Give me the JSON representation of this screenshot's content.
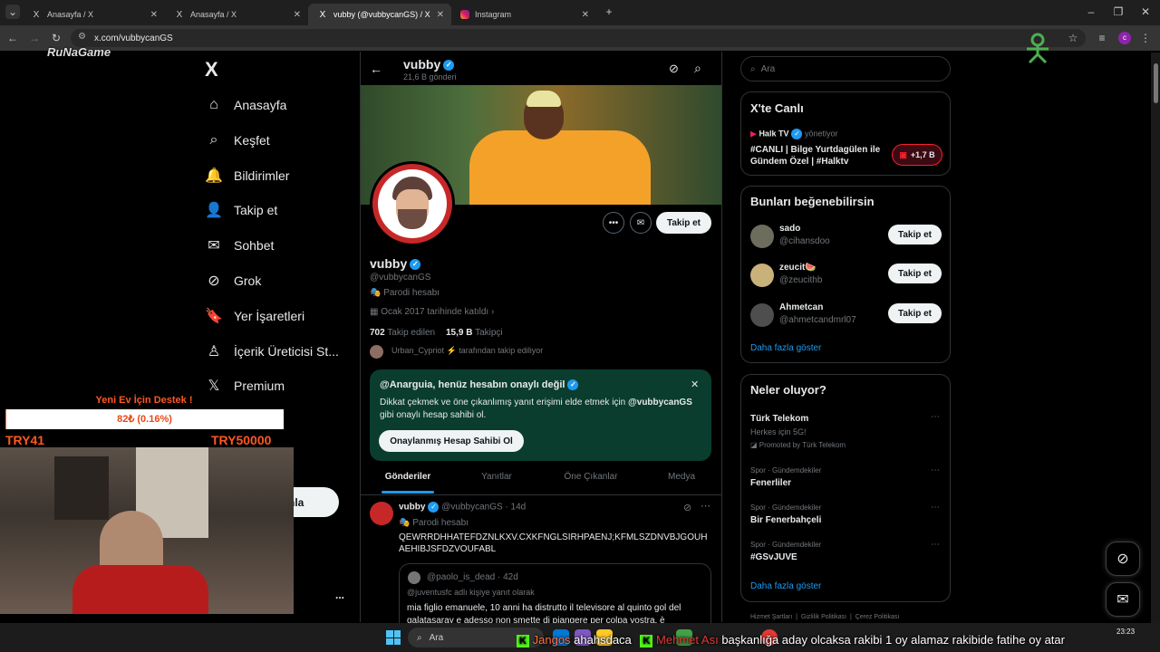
{
  "browser": {
    "tabs": [
      {
        "icon": "X",
        "title": "Anasayfa / X"
      },
      {
        "icon": "X",
        "title": "Anasayfa / X"
      },
      {
        "icon": "X",
        "title": "vubby (@vubbycanGS) / X"
      },
      {
        "icon": "IG",
        "title": "Instagram"
      }
    ],
    "url": "x.com/vubbycanGS"
  },
  "overlay": {
    "channel_logo": "RuNaGame",
    "donation_title": "Yeni Ev İçin Destek !",
    "donation_progress_text": "82₺ (0.16%)",
    "donation_progress": 0.0016,
    "donation_min": "TRY41",
    "donation_max": "TRY50000",
    "ticker": {
      "user1": "Jangos",
      "msg1": "ahahsdaca",
      "user2": "Mehmet Ası",
      "msg2": "başkanlığa aday olcaksa rakibi 1 oy alamaz rakibide fatihe oy atar"
    }
  },
  "sidebar": {
    "logo": "X",
    "items": [
      {
        "icon": "home-icon",
        "glyph": "⌂",
        "label": "Anasayfa"
      },
      {
        "icon": "search-icon",
        "glyph": "⌕",
        "label": "Keşfet"
      },
      {
        "icon": "bell-icon",
        "glyph": "🔔",
        "label": "Bildirimler"
      },
      {
        "icon": "person-add-icon",
        "glyph": "👤",
        "label": "Takip et"
      },
      {
        "icon": "mail-icon",
        "glyph": "✉",
        "label": "Sohbet"
      },
      {
        "icon": "grok-icon",
        "glyph": "⊘",
        "label": "Grok"
      },
      {
        "icon": "bookmark-icon",
        "glyph": "🔖",
        "label": "Yer İşaretleri"
      },
      {
        "icon": "creator-icon",
        "glyph": "♙",
        "label": "İçerik Üreticisi St..."
      },
      {
        "icon": "x-premium-icon",
        "glyph": "𝕏",
        "label": "Premium"
      }
    ],
    "post_button_partial": "nla",
    "more_dots": "..."
  },
  "profile": {
    "name": "vubby",
    "post_count": "21,6 B gönderi",
    "handle": "@vubbycanGS",
    "parody": "Parodi hesabı",
    "joined": "Ocak 2017 tarihinde katıldı",
    "following_count": "702",
    "following_label": "Takip edilen",
    "followers_count": "15,9 B",
    "followers_label": "Takipçi",
    "followed_by_user": "Urban_Cypriot",
    "followed_by_text": "tarafından takip ediliyor",
    "follow_button": "Takip et"
  },
  "verify_banner": {
    "title": "@Anarguia, henüz hesabın onaylı değil",
    "body_prefix": "Dikkat çekmek ve öne çıkanlımış yanıt erişimi elde etmek için",
    "body_handle": "@vubbycanGS",
    "body_suffix": "gibi onaylı hesap sahibi ol.",
    "button": "Onaylanmış Hesap Sahibi Ol"
  },
  "profile_tabs": [
    "Gönderiler",
    "Yanıtlar",
    "Öne Çıkanlar",
    "Medya"
  ],
  "post": {
    "name": "vubby",
    "handle": "@vubbycanGS",
    "time": "· 14d",
    "parody": "Parodi hesabı",
    "text": "QEWRRDHHATEFDZNLKXV.CXKFNGLSIRHPAENJ;KFMLSZDNVBJGOUHAEHIBJSFDZVOUFABL",
    "quote_user": "@paolo_is_dead",
    "quote_time": "· 42d",
    "quote_reply": "@juventusfc adlı kişiye yanıt olarak",
    "quote_text": "mia figlio emanuele, 10 anni ha distrutto il televisore al quinto gol del galatasaray e adesso non smette di piangere per colpa vostra, è"
  },
  "right": {
    "search_placeholder": "Ara",
    "live": {
      "title": "X'te Canlı",
      "host": "Halk TV",
      "host_role": "yönetiyor",
      "stream_title": "#CANLI | Bilge Yurtdagülen ile Gündem Özel | #Halktv",
      "listeners": "+1,7 B"
    },
    "suggest": {
      "title": "Bunları beğenebilirsin",
      "users": [
        {
          "name": "sado",
          "handle": "@cihansdoo",
          "button": "Takip et"
        },
        {
          "name": "zeucit🍉",
          "handle": "@zeucithb",
          "button": "Takip et"
        },
        {
          "name": "Ahmetcan",
          "handle": "@ahmetcandmrl07",
          "button": "Takip et"
        }
      ],
      "more": "Daha fazla göster"
    },
    "trends": {
      "title": "Neler oluyor?",
      "items": [
        {
          "context": "",
          "name": "Türk Telekom",
          "sub": "Herkes için 5G!",
          "promo": "Promoted by Türk Telekom"
        },
        {
          "context": "Spor · Gündemdekiler",
          "name": "Fenerliler"
        },
        {
          "context": "Spor · Gündemdekiler",
          "name": "Bir Fenerbahçeli"
        },
        {
          "context": "Spor · Gündemdekiler",
          "name": "#GSvJUVE"
        }
      ],
      "more": "Daha fazla göster"
    },
    "footer": [
      "Hizmet Şartları",
      "Gizlilik Politikası",
      "Çerez Politikası"
    ]
  },
  "taskbar": {
    "search": "Ara",
    "time": "23:23"
  }
}
